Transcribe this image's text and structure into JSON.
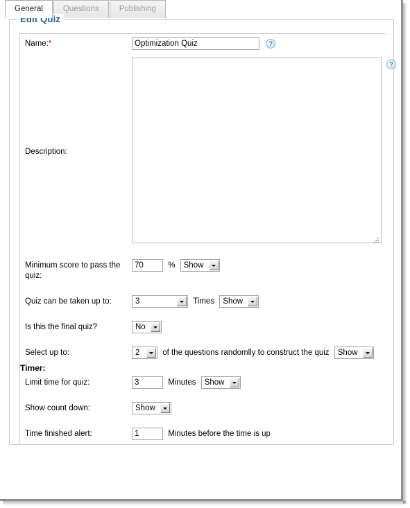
{
  "tabs": [
    {
      "label": "General",
      "active": true
    },
    {
      "label": "Questions",
      "active": false
    },
    {
      "label": "Publishing",
      "active": false
    }
  ],
  "fieldset": {
    "legend": "Edit Quiz"
  },
  "form": {
    "name": {
      "label": "Name:",
      "required_marker": "*",
      "value": "Optimization Quiz",
      "help_icon": "question-mark-icon"
    },
    "description": {
      "label": "Description:",
      "value": "",
      "help_icon": "question-mark-icon"
    },
    "min_score": {
      "label": "Minimum score to pass the quiz:",
      "value": "70",
      "unit": "%",
      "visibility": "Show"
    },
    "attempts": {
      "label": "Quiz can be taken up to:",
      "value": "3",
      "unit": "Times",
      "visibility": "Show"
    },
    "final_quiz": {
      "label": "Is this the final quiz?",
      "value": "No"
    },
    "random_select": {
      "label": "Select up to:",
      "value": "2",
      "suffix": "of the questions randomlly to construct the quiz",
      "visibility": "Show"
    },
    "timer_heading": "Timer:",
    "limit_time": {
      "label": "Limit time for quiz:",
      "value": "3",
      "unit": "Minutes",
      "visibility": "Show"
    },
    "count_down": {
      "label": "Show count down:",
      "value": "Show"
    },
    "time_alert": {
      "label": "Time finished alert:",
      "value": "1",
      "suffix": "Minutes before the time is up"
    }
  },
  "colors": {
    "legend": "#1c5d8e",
    "required": "#cc0000",
    "tab_inactive_text": "#9a9a9a",
    "border": "#c6c6c6"
  }
}
